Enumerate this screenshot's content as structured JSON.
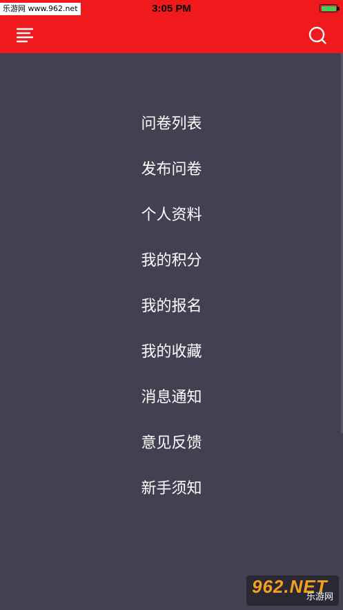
{
  "status_bar": {
    "site_badge": "乐游网 www.962.net",
    "time": "3:05 PM",
    "battery_level": 1.0,
    "battery_color": "#3cd25a"
  },
  "nav_bar": {
    "background": "#f0191c",
    "menu_icon": "hamburger-menu-icon",
    "search_icon": "search-icon"
  },
  "menu": {
    "items": [
      {
        "label": "问卷列表"
      },
      {
        "label": "发布问卷"
      },
      {
        "label": "个人资料"
      },
      {
        "label": "我的积分"
      },
      {
        "label": "我的报名"
      },
      {
        "label": "我的收藏"
      },
      {
        "label": "消息通知"
      },
      {
        "label": "意见反馈"
      },
      {
        "label": "新手须知"
      }
    ]
  },
  "watermark": {
    "logo_text": "962.NET",
    "sub_text": "乐游网"
  }
}
